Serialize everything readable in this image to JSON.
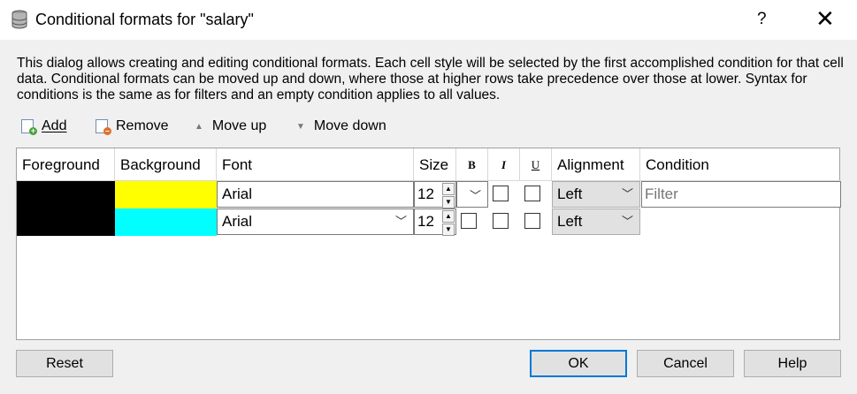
{
  "window": {
    "title": "Conditional formats for \"salary\"",
    "help_glyph": "?",
    "close_glyph": "✕"
  },
  "description": "This dialog allows creating and editing conditional formats. Each cell style will be selected by the first accomplished condition for that cell data. Conditional formats can be moved up and down, where those at higher rows take precedence over those at lower. Syntax for conditions is the same as for filters and an empty condition applies to all values.",
  "toolbar": {
    "add_label": "Add",
    "remove_label": "Remove",
    "move_up_label": "Move up",
    "move_down_label": "Move down"
  },
  "table": {
    "headers": {
      "foreground": "Foreground",
      "background": "Background",
      "font": "Font",
      "size": "Size",
      "bold": "B",
      "italic": "I",
      "underline": "U",
      "alignment": "Alignment",
      "condition": "Condition"
    },
    "rows": [
      {
        "foreground_color": "#000000",
        "background_color": "#ffff00",
        "font": "Arial",
        "size": "12",
        "bold": false,
        "italic": false,
        "underline": false,
        "alignment": "Left",
        "condition_placeholder": "Filter",
        "condition": ""
      },
      {
        "foreground_color": "#000000",
        "background_color": "#00ffff",
        "font": "Arial",
        "size": "12",
        "bold": false,
        "italic": false,
        "underline": false,
        "alignment": "Left"
      }
    ]
  },
  "buttons": {
    "reset": "Reset",
    "ok": "OK",
    "cancel": "Cancel",
    "help": "Help"
  },
  "colors": {
    "accent": "#0078d7"
  }
}
